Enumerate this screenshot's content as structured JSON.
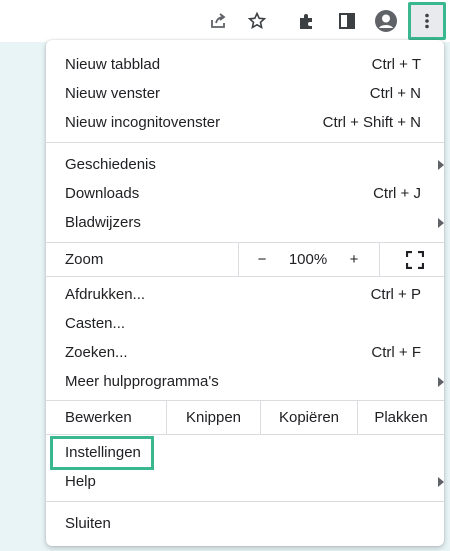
{
  "toolbar": {
    "icons": [
      "share-icon",
      "bookmark-star-icon",
      "extensions-icon",
      "side-panel-icon",
      "profile-icon",
      "kebab-menu-icon"
    ]
  },
  "menu": {
    "group1": [
      {
        "label": "Nieuw tabblad",
        "shortcut": "Ctrl + T"
      },
      {
        "label": "Nieuw venster",
        "shortcut": "Ctrl + N"
      },
      {
        "label": "Nieuw incognitovenster",
        "shortcut": "Ctrl + Shift + N"
      }
    ],
    "group2": [
      {
        "label": "Geschiedenis",
        "shortcut": ""
      },
      {
        "label": "Downloads",
        "shortcut": "Ctrl + J"
      },
      {
        "label": "Bladwijzers",
        "shortcut": ""
      }
    ],
    "zoom": {
      "label": "Zoom",
      "minus": "−",
      "value": "100%",
      "plus": "+"
    },
    "group3": [
      {
        "label": "Afdrukken...",
        "shortcut": "Ctrl + P"
      },
      {
        "label": "Casten...",
        "shortcut": ""
      },
      {
        "label": "Zoeken...",
        "shortcut": "Ctrl + F"
      },
      {
        "label": "Meer hulpprogramma's",
        "shortcut": ""
      }
    ],
    "edit": {
      "label": "Bewerken",
      "cut": "Knippen",
      "copy": "Kopiëren",
      "paste": "Plakken"
    },
    "group4": [
      {
        "label": "Instellingen"
      },
      {
        "label": "Help"
      }
    ],
    "exit": {
      "label": "Sluiten"
    }
  }
}
